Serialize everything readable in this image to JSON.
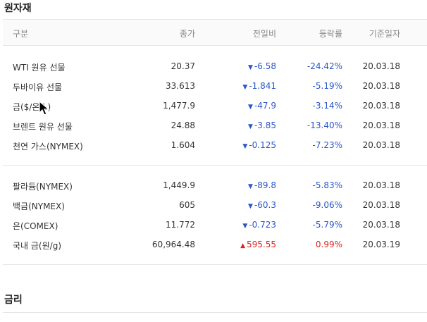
{
  "sections": {
    "commodities_title": "원자재",
    "rates_title": "금리"
  },
  "columns": [
    "구분",
    "종가",
    "전일비",
    "등락률",
    "기준일자"
  ],
  "group1": [
    {
      "name": "WTI 원유 선물",
      "price": "20.37",
      "dir": "down",
      "change": "-6.58",
      "rate": "-24.42%",
      "date": "20.03.18"
    },
    {
      "name": "두바이유 선물",
      "price": "33.613",
      "dir": "down",
      "change": "-1.841",
      "rate": "-5.19%",
      "date": "20.03.18"
    },
    {
      "name": "금($/온스)",
      "price": "1,477.9",
      "dir": "down",
      "change": "-47.9",
      "rate": "-3.14%",
      "date": "20.03.18"
    },
    {
      "name": "브렌트 원유 선물",
      "price": "24.88",
      "dir": "down",
      "change": "-3.85",
      "rate": "-13.40%",
      "date": "20.03.18"
    },
    {
      "name": "천연 가스(NYMEX)",
      "price": "1.604",
      "dir": "down",
      "change": "-0.125",
      "rate": "-7.23%",
      "date": "20.03.18"
    }
  ],
  "group2": [
    {
      "name": "팔라듐(NYMEX)",
      "price": "1,449.9",
      "dir": "down",
      "change": "-89.8",
      "rate": "-5.83%",
      "date": "20.03.18"
    },
    {
      "name": "백금(NYMEX)",
      "price": "605",
      "dir": "down",
      "change": "-60.3",
      "rate": "-9.06%",
      "date": "20.03.18"
    },
    {
      "name": "은(COMEX)",
      "price": "11.772",
      "dir": "down",
      "change": "-0.723",
      "rate": "-5.79%",
      "date": "20.03.18"
    },
    {
      "name": "국내 금(원/g)",
      "price": "60,964.48",
      "dir": "up",
      "change": "595.55",
      "rate": "0.99%",
      "date": "20.03.19"
    }
  ],
  "icons": {
    "down": "triangle-down",
    "up": "triangle-up"
  },
  "colors": {
    "down": "#2b56c6",
    "up": "#e02020"
  }
}
